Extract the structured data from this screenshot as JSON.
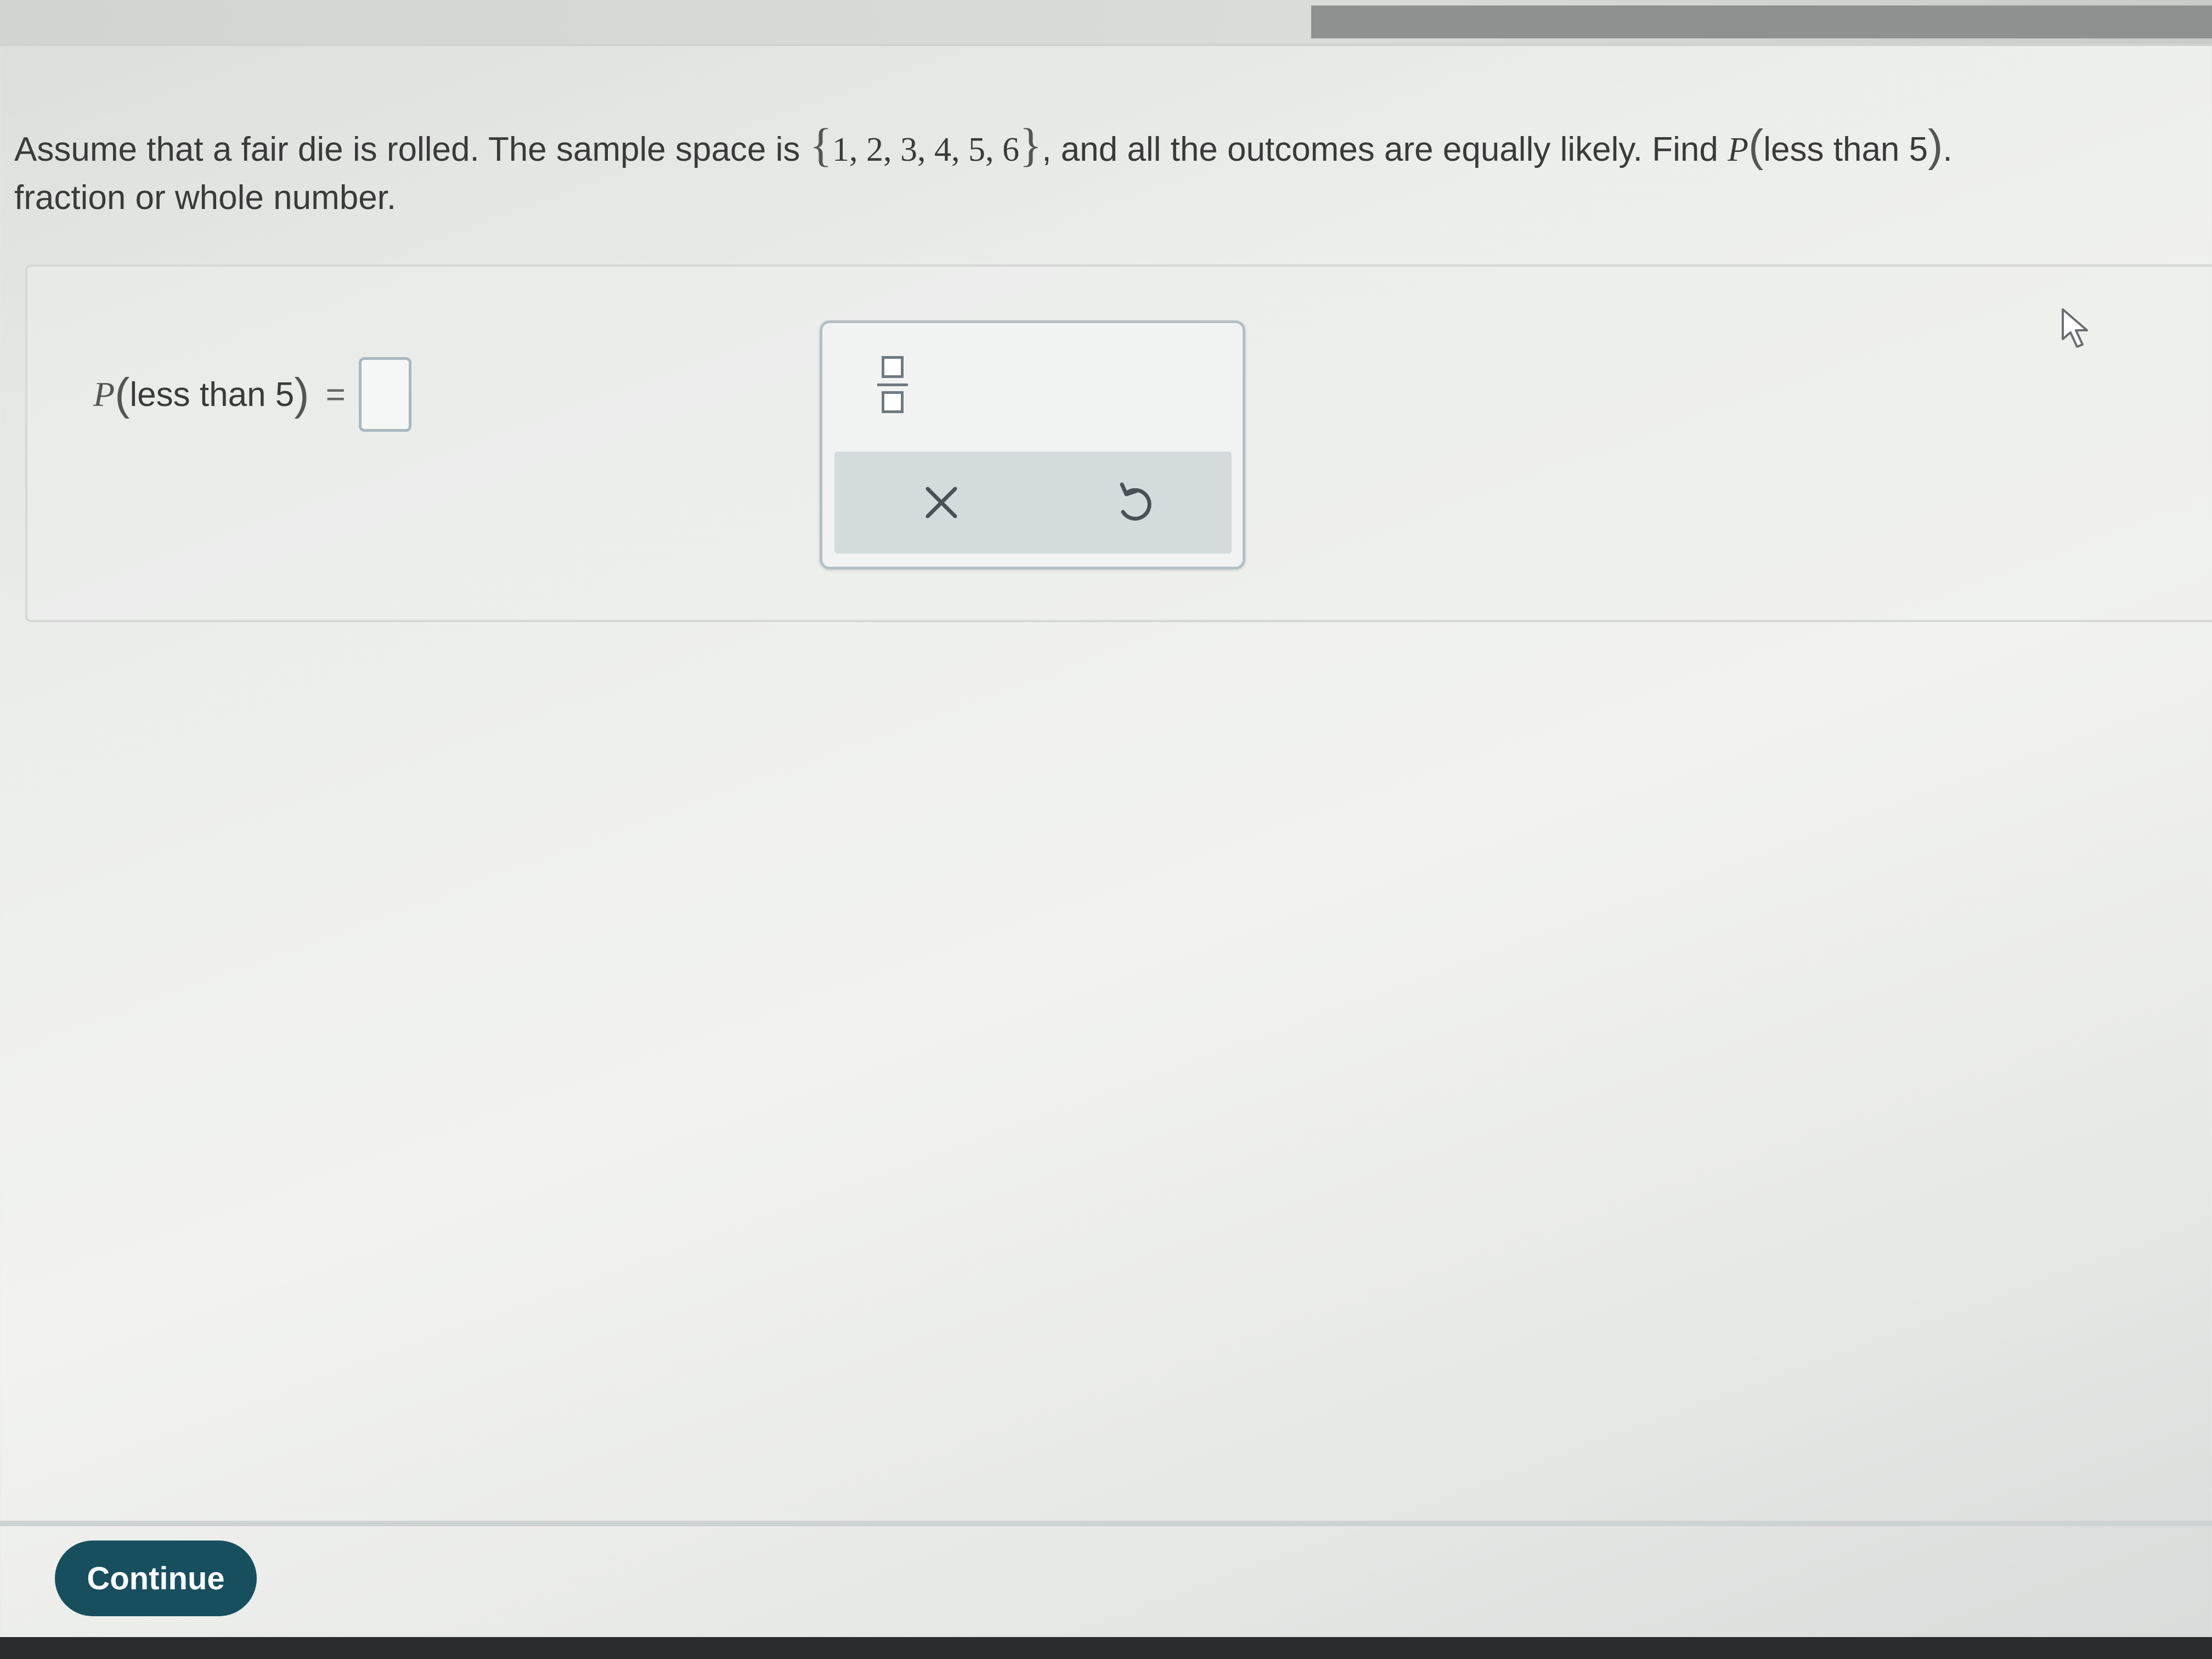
{
  "question": {
    "text_before_set": "Assume that a fair die is rolled. The sample space is",
    "sample_space": "1, 2, 3, 4, 5, 6",
    "text_after_set": ", and all the outcomes are equally likely. Find",
    "prob_symbol": "P",
    "event": "less than 5",
    "line2": "fraction or whole number."
  },
  "answer": {
    "prob_symbol": "P",
    "event": "less than 5",
    "equals": "=",
    "value": ""
  },
  "palette": {
    "fraction_icon": "fraction-icon",
    "clear_icon": "close-icon",
    "undo_icon": "undo-icon"
  },
  "footer": {
    "continue_label": "Continue"
  },
  "colors": {
    "continue_bg": "#174f5e",
    "palette_action_bg": "#d3dbdd"
  }
}
